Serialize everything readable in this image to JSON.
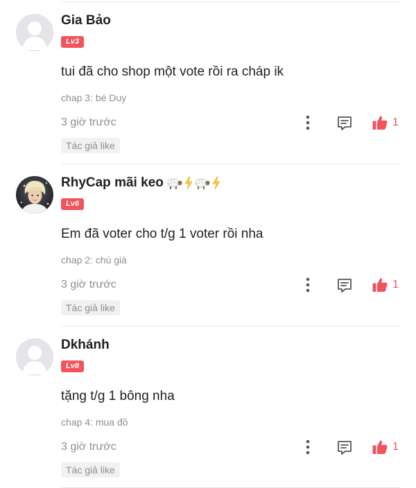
{
  "comments": [
    {
      "username": "Gia Bảo",
      "username_emoji": "",
      "level": "Lv3",
      "text": "tui đã cho shop một vote rồi ra cháp ik",
      "chapter": "chap 3: bé Duy",
      "time": "3 giờ trước",
      "likes": "1",
      "author_tag": "Tác giả like",
      "avatar": "default-avatar-icon"
    },
    {
      "username": "RhyCap mãi keo",
      "username_emoji": "🐑⚡🐑⚡",
      "level": "Lv6",
      "text": "Em đã voter cho t/g 1 voter rồi nha",
      "chapter": "chap 2: chú già",
      "time": "3 giờ trước",
      "likes": "1",
      "author_tag": "Tác giả like",
      "avatar": "user-photo-avatar"
    },
    {
      "username": "Dkhánh",
      "username_emoji": "",
      "level": "Lv8",
      "text": "tặng t/g 1 bông nha",
      "chapter": "chap 4: mua đồ",
      "time": "3 giờ trước",
      "likes": "1",
      "author_tag": "Tác giả like",
      "avatar": "default-avatar-icon"
    }
  ],
  "colors": {
    "accent": "#f2545b",
    "secondary_text": "#8e8e8e",
    "primary_text": "#1f1f1f",
    "tag_background": "#f1f1f1",
    "divider": "#e9e9e9"
  },
  "icons": {
    "more": "more-vertical-icon",
    "reply": "reply-comment-icon",
    "like": "thumbs-up-icon"
  }
}
